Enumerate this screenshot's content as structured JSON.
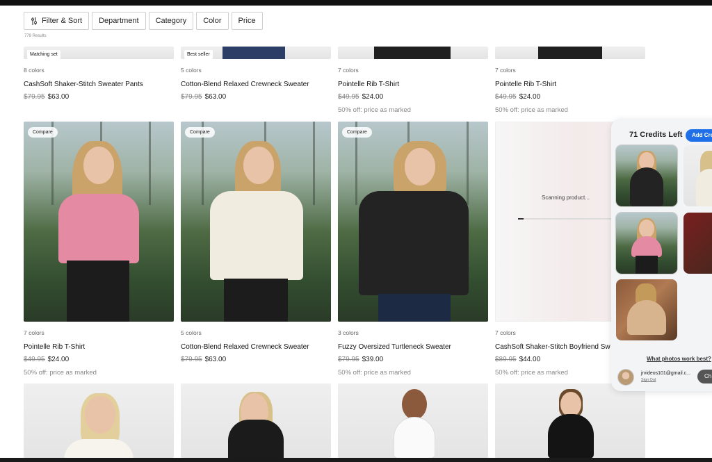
{
  "filters": {
    "filter_sort": "Filter & Sort",
    "department": "Department",
    "category": "Category",
    "color": "Color",
    "price": "Price",
    "results": "779 Results"
  },
  "row1": [
    {
      "tag": "Matching set",
      "colors": "8 colors",
      "name": "CashSoft Shaker-Stitch Sweater Pants",
      "old": "$79.95",
      "price": "$63.00",
      "note": ""
    },
    {
      "tag": "Best seller",
      "colors": "5 colors",
      "name": "Cotton-Blend Relaxed Crewneck Sweater",
      "old": "$79.95",
      "price": "$63.00",
      "note": ""
    },
    {
      "tag": "",
      "colors": "7 colors",
      "name": "Pointelle Rib T-Shirt",
      "old": "$49.95",
      "price": "$24.00",
      "note": "50% off: price as marked"
    },
    {
      "tag": "",
      "colors": "7 colors",
      "name": "Pointelle Rib T-Shirt",
      "old": "$49.95",
      "price": "$24.00",
      "note": "50% off: price as marked"
    }
  ],
  "row2": [
    {
      "compare": "Compare",
      "colors": "7 colors",
      "name": "Pointelle Rib T-Shirt",
      "old": "$49.95",
      "price": "$24.00",
      "note": "50% off: price as marked",
      "top_color": "#e58aa3"
    },
    {
      "compare": "Compare",
      "colors": "5 colors",
      "name": "Cotton-Blend Relaxed Crewneck Sweater",
      "old": "$79.95",
      "price": "$63.00",
      "note": "",
      "top_color": "#f1ece0"
    },
    {
      "compare": "Compare",
      "colors": "3 colors",
      "name": "Fuzzy Oversized Turtleneck Sweater",
      "old": "$79.95",
      "price": "$39.00",
      "note": "50% off: price as marked",
      "top_color": "#232323"
    },
    {
      "scanning": "Scanning product...",
      "scan_progress": 0.05,
      "colors": "7 colors",
      "name": "CashSoft Shaker-Stitch Boyfriend Sw",
      "old": "$89.95",
      "price": "$44.00",
      "note": "50% off: price as marked"
    }
  ],
  "panel": {
    "credits": "71 Credits Left",
    "add_button": "Add Cre",
    "help_link": "What photos work best?",
    "email": "jrvideos101@gmail.c...",
    "sign_out": "Sign Out",
    "ch_button": "Ch"
  },
  "colors": {
    "accent": "#1f6fe8"
  }
}
